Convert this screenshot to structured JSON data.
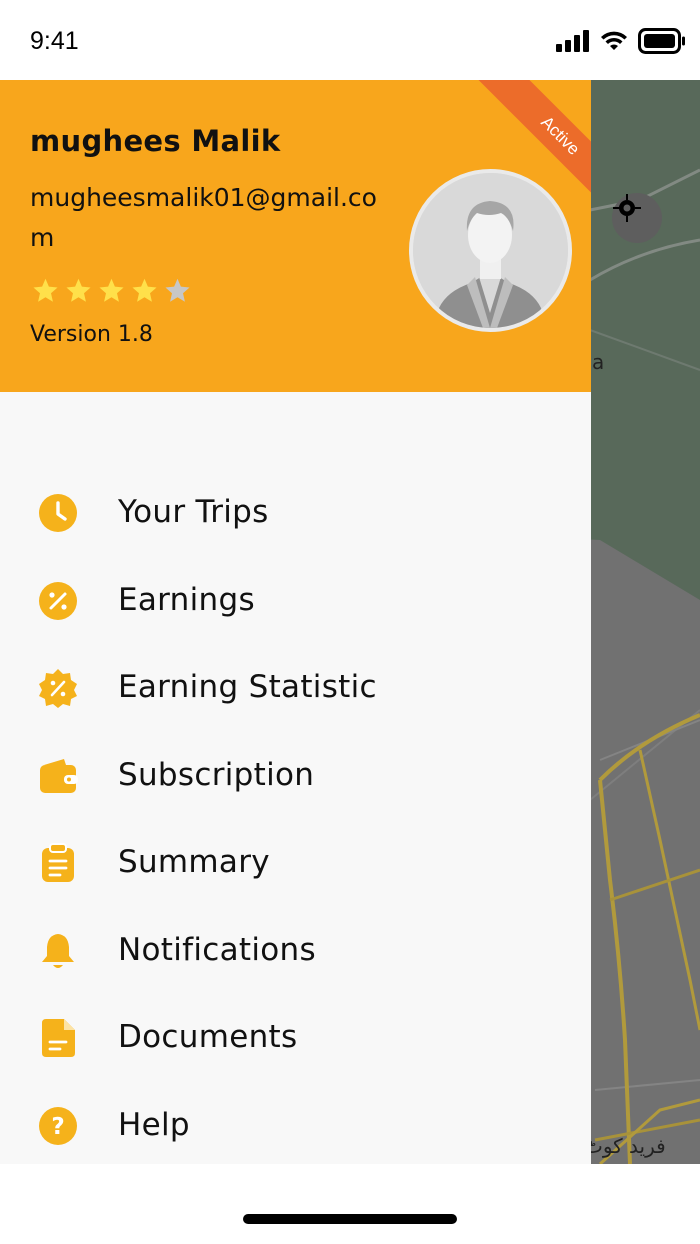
{
  "status_bar": {
    "time": "9:41"
  },
  "map": {
    "label_fragment": "a",
    "place_label": "فرید کوٹ"
  },
  "drawer": {
    "header": {
      "name": "mughees Malik",
      "email": "mugheesmalik01@gmail.com",
      "rating": 4,
      "rating_max": 5,
      "version": "Version 1.8",
      "badge": "Active",
      "colors": {
        "header_bg": "#f8a61c",
        "badge_bg": "#ec6c2a"
      }
    },
    "menu": [
      {
        "label": "Your Trips",
        "icon": "clock-icon"
      },
      {
        "label": "Earnings",
        "icon": "percent-circle-icon"
      },
      {
        "label": "Earning Statistic",
        "icon": "discount-badge-icon"
      },
      {
        "label": "Subscription",
        "icon": "wallet-icon"
      },
      {
        "label": "Summary",
        "icon": "clipboard-icon"
      },
      {
        "label": "Notifications",
        "icon": "bell-icon"
      },
      {
        "label": "Documents",
        "icon": "document-icon"
      },
      {
        "label": "Help",
        "icon": "help-circle-icon"
      }
    ],
    "accent_color": "#f5b21b"
  }
}
